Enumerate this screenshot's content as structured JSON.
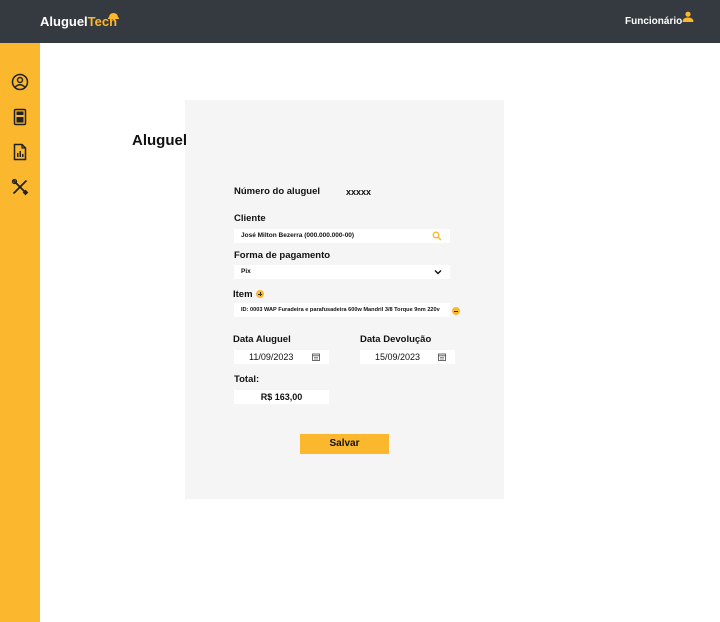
{
  "header": {
    "logo_part1": "Aluguel",
    "logo_part2": "Tech",
    "user_label": "Funcionário"
  },
  "sidebar": {
    "items": [
      {
        "icon": "user-circle-icon"
      },
      {
        "icon": "calculator-icon"
      },
      {
        "icon": "report-chart-icon"
      },
      {
        "icon": "tools-icon"
      }
    ]
  },
  "form": {
    "title": "Aluguel",
    "rental_number_label": "Número do aluguel",
    "rental_number_value": "xxxxx",
    "client_label": "Cliente",
    "client_value": "José Milton Bezerra (000.000.000-00)",
    "payment_label": "Forma de pagamento",
    "payment_value": "Pix",
    "item_label": "Item",
    "item_value": "ID: 0003    WAP Furadeira e parafusadeira    600w Mandril 3/8 Torque 9nm 220v",
    "rental_date_label": "Data Aluguel",
    "rental_date_value": "11/09/2023",
    "return_date_label": "Data Devolução",
    "return_date_value": "15/09/2023",
    "total_label": "Total:",
    "total_value": "R$ 163,00",
    "save_label": "Salvar"
  },
  "colors": {
    "topbar": "#343a40",
    "accent": "#fbb82e",
    "card": "#f5f5f5"
  }
}
